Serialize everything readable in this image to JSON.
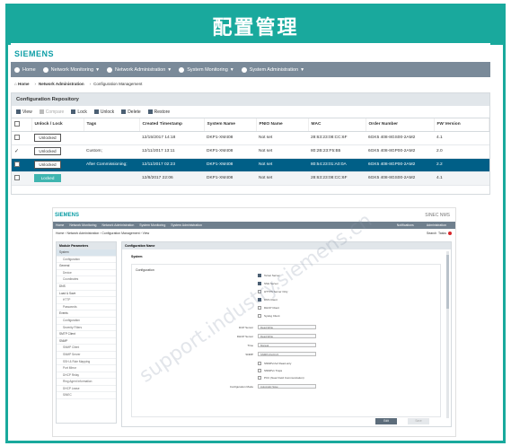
{
  "banner": {
    "title": "配置管理"
  },
  "brand": "SIEMENS",
  "shot1": {
    "nav": [
      "Home",
      "Network Monitoring",
      "Network Administration",
      "System Monitoring",
      "System Administration"
    ],
    "breadcrumb": [
      "Home",
      "Network Administration",
      "Configuration Management"
    ],
    "panel_title": "Configuration Repository",
    "toolbar": [
      "View",
      "Compare",
      "Lock",
      "Unlock",
      "Delete",
      "Restore"
    ],
    "columns": [
      "",
      "Unlock / Lock",
      "Tags",
      "Created Timestamp",
      "System Name",
      "PNIO Name",
      "MAC",
      "Order Number",
      "FW Version"
    ],
    "rows": [
      {
        "check": "",
        "lock": "Unlocked",
        "tags": "",
        "created": "12/15/2017 14:18",
        "system": "DKP1-XM408",
        "pnio": "Not set",
        "mac": "28:63:23:08:CC:6F",
        "order": "6GK5 408-8GS00-2AM2",
        "fw": "4.1"
      },
      {
        "check": "✓",
        "lock": "Unlocked",
        "tags": "Custom;",
        "created": "12/11/2017 13:11",
        "system": "DKP1-XM408",
        "pnio": "Not set",
        "mac": "80:2B:23:F5:B5",
        "order": "6GK5 408-8GP00-2AM2",
        "fw": "2.0"
      },
      {
        "check": "",
        "lock": "Unlocked",
        "tags": "After Commissioning;",
        "created": "12/11/2017 02:23",
        "system": "DKP1-XM408",
        "pnio": "Not set",
        "mac": "80:54:23:01:A0:0A",
        "order": "6GK5 408-8GP00-2AM2",
        "fw": "2.2"
      },
      {
        "check": "",
        "lock": "Locked",
        "tags": "",
        "created": "12/8/2017 22:06",
        "system": "DKP1-XM408",
        "pnio": "Not set",
        "mac": "28:63:23:08:CC:6F",
        "order": "6GK5 408-8GS00-2AM2",
        "fw": "4.1"
      }
    ]
  },
  "shot2": {
    "brand": "SIEMENS",
    "product": "SINEC NMS",
    "nav": [
      "Home",
      "Network Monitoring",
      "Network Administration",
      "System Monitoring",
      "System Administration"
    ],
    "nav_right": [
      "Notifications",
      "Administration"
    ],
    "breadcrumb": "Home › Network Administration › Configuration Management › View",
    "breadcrumb_right": [
      "Search",
      "Tasks"
    ],
    "side_title": "Module Parameters",
    "side_items": [
      {
        "label": "System",
        "sub": false,
        "active": true
      },
      {
        "label": "Configuration",
        "sub": true
      },
      {
        "label": "General",
        "sub": false
      },
      {
        "label": "Device",
        "sub": true
      },
      {
        "label": "Coordinates",
        "sub": true
      },
      {
        "label": "DNS",
        "sub": false
      },
      {
        "label": "Load & Save",
        "sub": false
      },
      {
        "label": "HTTP",
        "sub": true
      },
      {
        "label": "Passwords",
        "sub": true
      },
      {
        "label": "Events",
        "sub": false
      },
      {
        "label": "Configuration",
        "sub": true
      },
      {
        "label": "Severity Filters",
        "sub": true
      },
      {
        "label": "SMTP Client",
        "sub": false
      },
      {
        "label": "SNMP",
        "sub": false
      },
      {
        "label": "SNMP Client",
        "sub": true
      },
      {
        "label": "SNMP Server",
        "sub": true
      },
      {
        "label": "SSH & Role Mapping",
        "sub": true
      },
      {
        "label": "Port Mirror",
        "sub": true
      },
      {
        "label": "DHCP Relay",
        "sub": true
      },
      {
        "label": "Ring Agent Information",
        "sub": true
      },
      {
        "label": "DHCP Lease",
        "sub": true
      },
      {
        "label": "SINEC",
        "sub": true
      }
    ],
    "main_title": "Configuration Name",
    "section": "System",
    "box_label": "Configuration",
    "options": [
      {
        "label": "Telnet Server",
        "on": true
      },
      {
        "label": "SSH Server",
        "on": true
      },
      {
        "label": "HTTPS Server Only",
        "on": false
      },
      {
        "label": "DNS Client",
        "on": true
      },
      {
        "label": "DHCP Client",
        "on": false
      },
      {
        "label": "Syslog Client",
        "on": false
      }
    ],
    "fields": [
      {
        "label": "DCP Server",
        "value": "Read-Write"
      },
      {
        "label": "DHCP Server",
        "value": "Read-Write"
      },
      {
        "label": "Time",
        "value": "Manual"
      },
      {
        "label": "SNMP",
        "value": "SNMPv1/v2c/v3"
      }
    ],
    "options2": [
      {
        "label": "SNMPv1/v2 Read-only",
        "on": false
      },
      {
        "label": "SNMPv1 Traps",
        "on": false
      },
      {
        "label": "PCC (Near Field Communication)",
        "on": false
      }
    ],
    "config_mode": {
      "label": "Configuration Mode",
      "value": "Automatic Save"
    },
    "buttons": [
      "Edit",
      "Save"
    ]
  },
  "watermark": "support.industry.siemens.cn"
}
